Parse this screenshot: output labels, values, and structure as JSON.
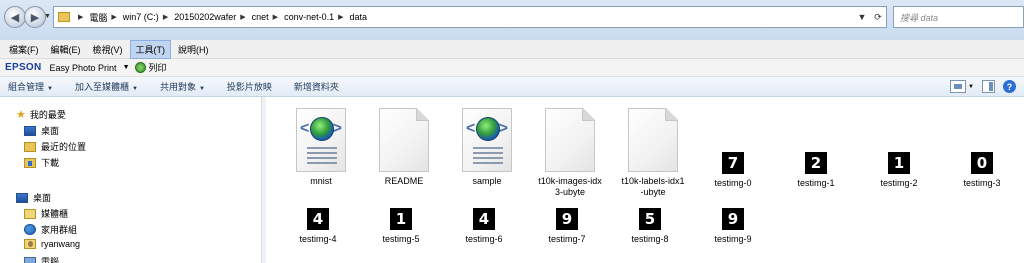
{
  "address": {
    "crumbs": [
      "電腦",
      "win7 (C:)",
      "20150202wafer",
      "cnet",
      "conv-net-0.1",
      "data"
    ],
    "search_placeholder": "搜尋 data"
  },
  "menu": {
    "items": [
      "檔案(F)",
      "編輯(E)",
      "檢視(V)",
      "工具(T)",
      "說明(H)"
    ],
    "active_index": 3
  },
  "epson": {
    "brand": "EPSON",
    "app": "Easy Photo Print",
    "print_label": "列印"
  },
  "commands": [
    "組合管理",
    "加入至媒體櫃",
    "共用對象",
    "投影片放映",
    "新增資料夾"
  ],
  "nav": {
    "favorites_label": "我的最愛",
    "favorites": [
      "桌面",
      "最近的位置",
      "下載"
    ],
    "desktop_label": "桌面",
    "desktop_children": [
      "媒體櫃",
      "家用群組",
      "ryanwang",
      "電腦"
    ]
  },
  "files": [
    {
      "name": "mnist",
      "kind": "web"
    },
    {
      "name": "README",
      "kind": "blank"
    },
    {
      "name": "sample",
      "kind": "web"
    },
    {
      "name": "t10k-images-idx3-ubyte",
      "line1": "t10k-images-idx",
      "line2": "3-ubyte",
      "kind": "blank"
    },
    {
      "name": "t10k-labels-idx1-ubyte",
      "line1": "t10k-labels-idx1",
      "line2": "-ubyte",
      "kind": "blank"
    },
    {
      "name": "testimg-0",
      "digit": "7",
      "kind": "image"
    },
    {
      "name": "testimg-1",
      "digit": "2",
      "kind": "image"
    },
    {
      "name": "testimg-2",
      "digit": "1",
      "kind": "image"
    },
    {
      "name": "testimg-3",
      "digit": "0",
      "kind": "image"
    },
    {
      "name": "testimg-4",
      "digit": "4",
      "kind": "image"
    },
    {
      "name": "testimg-5",
      "digit": "1",
      "kind": "image"
    },
    {
      "name": "testimg-6",
      "digit": "4",
      "kind": "image"
    },
    {
      "name": "testimg-7",
      "digit": "9",
      "kind": "image"
    },
    {
      "name": "testimg-8",
      "digit": "5",
      "kind": "image"
    },
    {
      "name": "testimg-9",
      "digit": "9",
      "kind": "image"
    }
  ]
}
